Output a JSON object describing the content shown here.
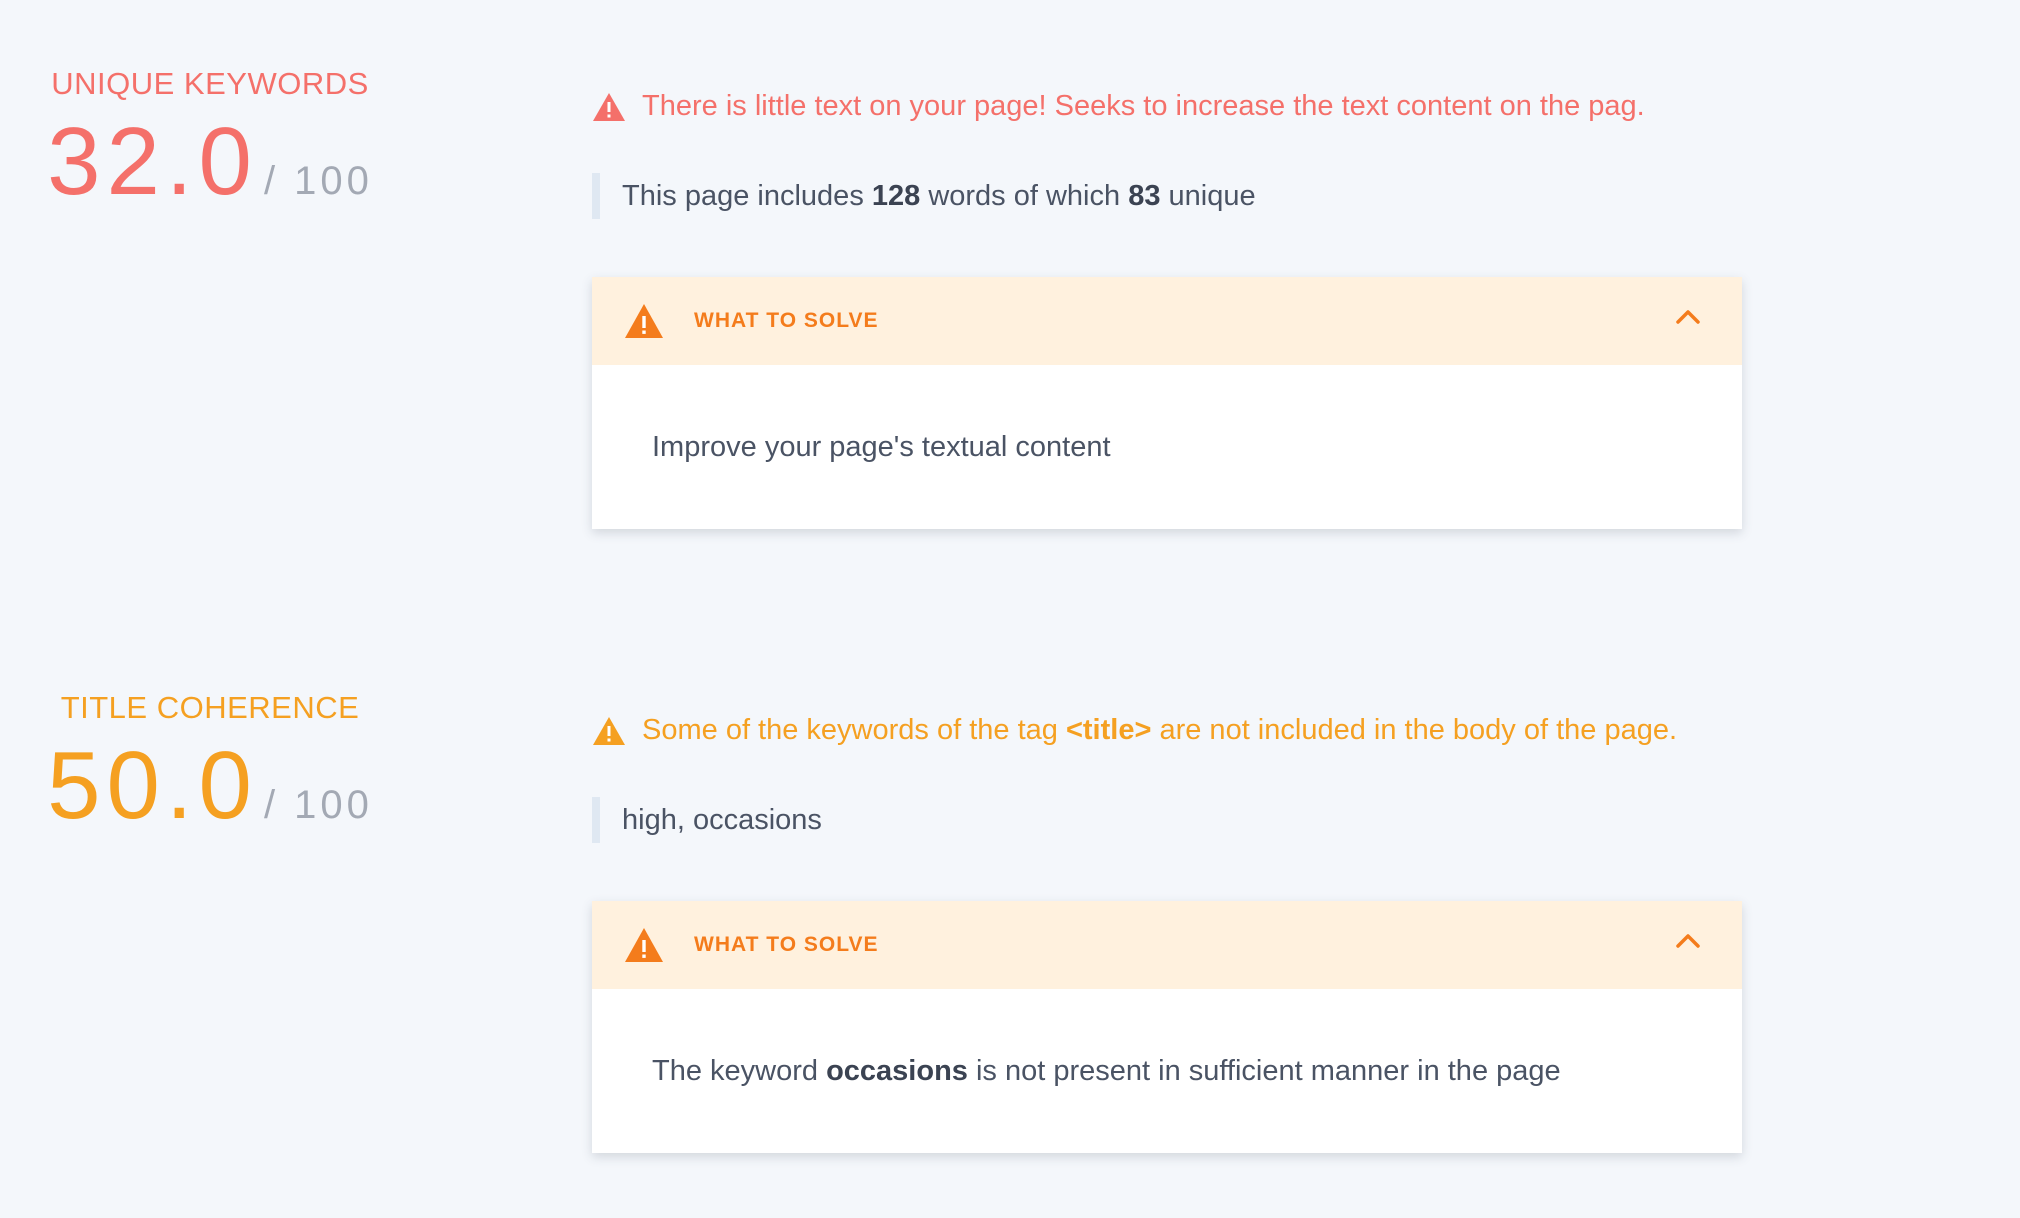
{
  "sections": [
    {
      "metric_title": "UNIQUE KEYWORDS",
      "score": "32.0",
      "score_max": "/ 100",
      "accent": "#f4706a",
      "alert": {
        "text": "There is little text on your page! Seeks to increase the text content on the pag."
      },
      "detail": {
        "prefix": "This page includes ",
        "words": "128",
        "middle": " words of which ",
        "unique": "83",
        "suffix": " unique"
      },
      "card": {
        "title": "WHAT TO SOLVE",
        "body": "Improve your page's textual content"
      }
    },
    {
      "metric_title": "TITLE COHERENCE",
      "score": "50.0",
      "score_max": "/ 100",
      "accent": "#f5a021",
      "alert": {
        "prefix": "Some of the keywords of the tag ",
        "tag": "<title>",
        "suffix": " are not included in the body of the page."
      },
      "detail": {
        "text": "high, occasions"
      },
      "card": {
        "title": "WHAT TO SOLVE",
        "body_prefix": "The keyword ",
        "keyword": "occasions",
        "body_suffix": " is not present in sufficient manner in the page"
      }
    }
  ],
  "colors": {
    "background": "#f4f7fb",
    "card_header": "#fff1de",
    "card_title": "#f47c1c",
    "red": "#f4706a",
    "orange": "#f5a021"
  },
  "icons": [
    "warning-triangle-icon",
    "chevron-up-icon"
  ]
}
